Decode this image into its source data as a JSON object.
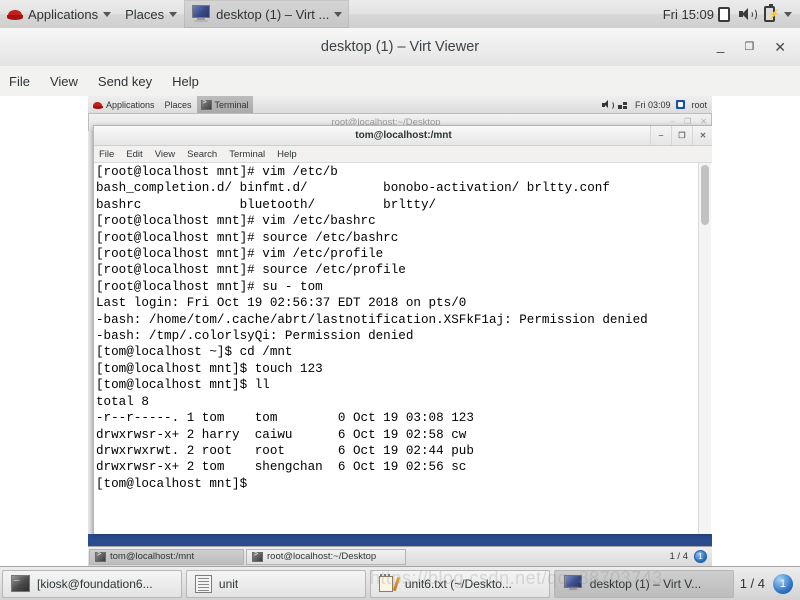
{
  "host_panel": {
    "applications_label": "Applications",
    "places_label": "Places",
    "window_item_label": "desktop (1) – Virt ...",
    "clock": "Fri 15:09",
    "icons": [
      "redhat-logo-icon",
      "note-icon",
      "speaker-icon",
      "battery-icon",
      "chevron-down-icon"
    ]
  },
  "virt_viewer": {
    "title": "desktop (1) – Virt Viewer",
    "window_buttons": {
      "minimize": "‒",
      "maximize": "❐",
      "close": "✕"
    },
    "menu": [
      "File",
      "View",
      "Send key",
      "Help"
    ]
  },
  "guest_panel": {
    "applications_label": "Applications",
    "places_label": "Places",
    "window_label": "Terminal",
    "clock": "Fri 03:09",
    "user": "root"
  },
  "background_window": {
    "title": "root@localhost:~/Desktop",
    "buttons": [
      "‒",
      "❐",
      "✕"
    ]
  },
  "terminal": {
    "title": "tom@localhost:/mnt",
    "menu": [
      "File",
      "Edit",
      "View",
      "Search",
      "Terminal",
      "Help"
    ],
    "buttons": {
      "minimize": "‒",
      "maximize": "❐",
      "close": "✕"
    },
    "lines": [
      "[root@localhost mnt]# vim /etc/b",
      "bash_completion.d/ binfmt.d/          bonobo-activation/ brltty.conf",
      "bashrc             bluetooth/         brltty/",
      "[root@localhost mnt]# vim /etc/bashrc",
      "[root@localhost mnt]# source /etc/bashrc",
      "[root@localhost mnt]# vim /etc/profile",
      "[root@localhost mnt]# source /etc/profile",
      "[root@localhost mnt]# su - tom",
      "Last login: Fri Oct 19 02:56:37 EDT 2018 on pts/0",
      "-bash: /home/tom/.cache/abrt/lastnotification.XSFkF1aj: Permission denied",
      "-bash: /tmp/.colorlsyQi: Permission denied",
      "[tom@localhost ~]$ cd /mnt",
      "[tom@localhost mnt]$ touch 123",
      "[tom@localhost mnt]$ ll",
      "total 8",
      "-r--r-----. 1 tom    tom        0 Oct 19 03:08 123",
      "drwxrwsr-x+ 2 harry  caiwu      6 Oct 19 02:58 cw",
      "drwxrwxrwt. 2 root   root       6 Oct 19 02:44 pub",
      "drwxrwsr-x+ 2 tom    shengchan  6 Oct 19 02:56 sc",
      "[tom@localhost mnt]$"
    ]
  },
  "guest_taskbar": {
    "items": [
      {
        "label": "tom@localhost:/mnt",
        "selected": true
      },
      {
        "label": "root@localhost:~/Desktop",
        "selected": false
      }
    ],
    "pager": "1 / 4",
    "workspace_badge": "1"
  },
  "host_taskbar": {
    "items": [
      {
        "label": "[kiosk@foundation6...",
        "icon": "terminal-icon",
        "selected": false
      },
      {
        "label": "unit",
        "icon": "document-icon",
        "selected": false
      },
      {
        "label": "unit6.txt (~/Deskto...",
        "icon": "text-editor-icon",
        "selected": false
      },
      {
        "label": "desktop (1) – Virt V...",
        "icon": "monitor-icon",
        "selected": true
      }
    ],
    "pager": "1 / 4",
    "workspace_badge": "1"
  },
  "watermark": {
    "text": "https://blog.csdn.net/qq_38703743"
  },
  "colors": {
    "desktop_blue": "#2a4b8d",
    "panel_gray": "#e3e3e3",
    "terminal_bg": "#ffffff",
    "terminal_fg": "#000000"
  }
}
